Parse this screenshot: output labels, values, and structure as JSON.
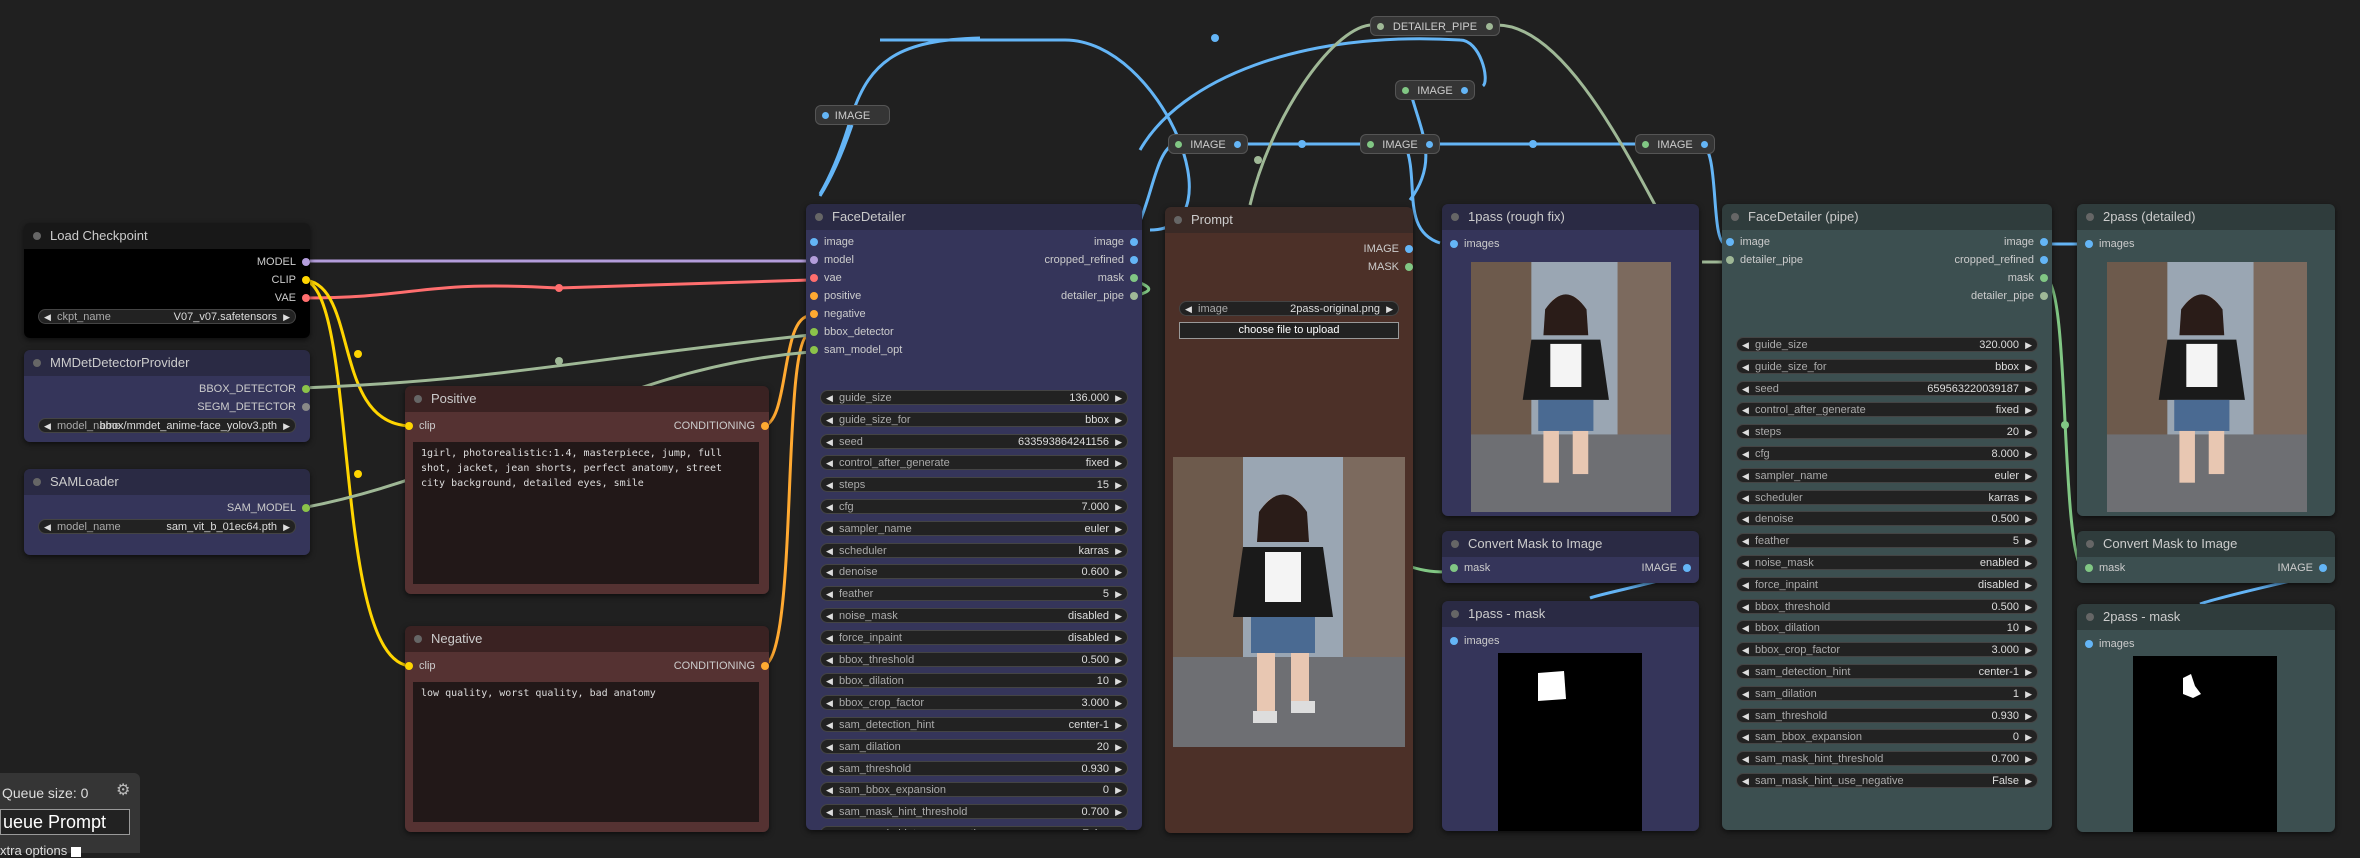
{
  "colors": {
    "model": "#b39ddb",
    "clip": "#ffd500",
    "vae": "#ff6e6e",
    "image": "#64b5f6",
    "bbox": "#8bc34a",
    "pipe": "#9fb896",
    "conditioning": "#ffa931",
    "mask": "#81c784"
  },
  "reroutes": {
    "image1": "IMAGE",
    "image2": "IMAGE",
    "image3": "IMAGE",
    "image4": "IMAGE",
    "image5": "IMAGE",
    "detailer_pipe": "DETAILER_PIPE"
  },
  "load_checkpoint": {
    "title": "Load Checkpoint",
    "out_model": "MODEL",
    "out_clip": "CLIP",
    "out_vae": "VAE",
    "ckpt_label": "ckpt_name",
    "ckpt_value": "V07_v07.safetensors"
  },
  "mmdet": {
    "title": "MMDetDetectorProvider",
    "out_bbox": "BBOX_DETECTOR",
    "out_segm": "SEGM_DETECTOR",
    "model_label": "model_name",
    "model_value": "bbox/mmdet_anime-face_yolov3.pth"
  },
  "samloader": {
    "title": "SAMLoader",
    "out": "SAM_MODEL",
    "model_label": "model_name",
    "model_value": "sam_vit_b_01ec64.pth"
  },
  "positive": {
    "title": "Positive",
    "in_clip": "clip",
    "out": "CONDITIONING",
    "text": "1girl, photorealistic:1.4, masterpiece, jump, full shot, jacket, jean shorts, perfect anatomy, street city background, detailed eyes, smile"
  },
  "negative": {
    "title": "Negative",
    "in_clip": "clip",
    "out": "CONDITIONING",
    "text": "low quality, worst quality, bad anatomy"
  },
  "facedetailer": {
    "title": "FaceDetailer",
    "inputs": [
      "image",
      "model",
      "vae",
      "positive",
      "negative",
      "bbox_detector",
      "sam_model_opt"
    ],
    "outputs": [
      "image",
      "cropped_refined",
      "mask",
      "detailer_pipe"
    ],
    "widgets": [
      {
        "label": "guide_size",
        "value": "136.000"
      },
      {
        "label": "guide_size_for",
        "value": "bbox"
      },
      {
        "label": "seed",
        "value": "633593864241156"
      },
      {
        "label": "control_after_generate",
        "value": "fixed"
      },
      {
        "label": "steps",
        "value": "15"
      },
      {
        "label": "cfg",
        "value": "7.000"
      },
      {
        "label": "sampler_name",
        "value": "euler"
      },
      {
        "label": "scheduler",
        "value": "karras"
      },
      {
        "label": "denoise",
        "value": "0.600"
      },
      {
        "label": "feather",
        "value": "5"
      },
      {
        "label": "noise_mask",
        "value": "disabled"
      },
      {
        "label": "force_inpaint",
        "value": "disabled"
      },
      {
        "label": "bbox_threshold",
        "value": "0.500"
      },
      {
        "label": "bbox_dilation",
        "value": "10"
      },
      {
        "label": "bbox_crop_factor",
        "value": "3.000"
      },
      {
        "label": "sam_detection_hint",
        "value": "center-1"
      },
      {
        "label": "sam_dilation",
        "value": "20"
      },
      {
        "label": "sam_threshold",
        "value": "0.930"
      },
      {
        "label": "sam_bbox_expansion",
        "value": "0"
      },
      {
        "label": "sam_mask_hint_threshold",
        "value": "0.700"
      },
      {
        "label": "sam_mask_hint_use_negative",
        "value": "False"
      }
    ]
  },
  "prompt": {
    "title": "Prompt",
    "out_image": "IMAGE",
    "out_mask": "MASK",
    "image_label": "image",
    "image_value": "2pass-original.png",
    "upload": "choose file to upload"
  },
  "pass1": {
    "title": "1pass (rough fix)",
    "in": "images"
  },
  "cmask1": {
    "title": "Convert Mask to Image",
    "in": "mask",
    "out": "IMAGE"
  },
  "pass1mask": {
    "title": "1pass - mask",
    "in": "images"
  },
  "fdpipe": {
    "title": "FaceDetailer (pipe)",
    "inputs": [
      "image",
      "detailer_pipe"
    ],
    "outputs": [
      "image",
      "cropped_refined",
      "mask",
      "detailer_pipe"
    ],
    "widgets": [
      {
        "label": "guide_size",
        "value": "320.000"
      },
      {
        "label": "guide_size_for",
        "value": "bbox"
      },
      {
        "label": "seed",
        "value": "659563220039187"
      },
      {
        "label": "control_after_generate",
        "value": "fixed"
      },
      {
        "label": "steps",
        "value": "20"
      },
      {
        "label": "cfg",
        "value": "8.000"
      },
      {
        "label": "sampler_name",
        "value": "euler"
      },
      {
        "label": "scheduler",
        "value": "karras"
      },
      {
        "label": "denoise",
        "value": "0.500"
      },
      {
        "label": "feather",
        "value": "5"
      },
      {
        "label": "noise_mask",
        "value": "enabled"
      },
      {
        "label": "force_inpaint",
        "value": "disabled"
      },
      {
        "label": "bbox_threshold",
        "value": "0.500"
      },
      {
        "label": "bbox_dilation",
        "value": "10"
      },
      {
        "label": "bbox_crop_factor",
        "value": "3.000"
      },
      {
        "label": "sam_detection_hint",
        "value": "center-1"
      },
      {
        "label": "sam_dilation",
        "value": "1"
      },
      {
        "label": "sam_threshold",
        "value": "0.930"
      },
      {
        "label": "sam_bbox_expansion",
        "value": "0"
      },
      {
        "label": "sam_mask_hint_threshold",
        "value": "0.700"
      },
      {
        "label": "sam_mask_hint_use_negative",
        "value": "False"
      }
    ]
  },
  "pass2": {
    "title": "2pass (detailed)",
    "in": "images"
  },
  "cmask2": {
    "title": "Convert Mask to Image",
    "in": "mask",
    "out": "IMAGE"
  },
  "pass2mask": {
    "title": "2pass - mask",
    "in": "images"
  },
  "menu": {
    "queue_size": "Queue size: 0",
    "queue_prompt": "ueue Prompt",
    "extra": "xtra options"
  }
}
